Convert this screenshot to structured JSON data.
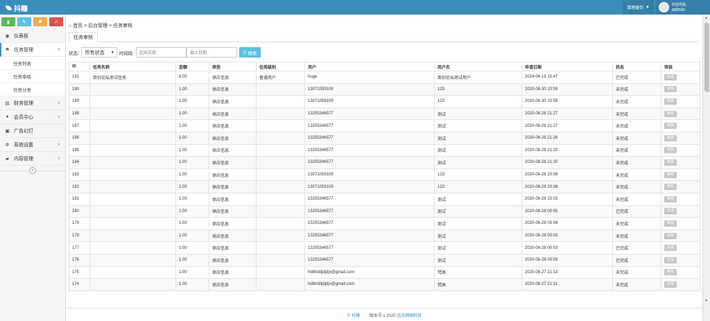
{
  "header": {
    "logo": "抖赚",
    "cache_label": "清理缓存",
    "user_greeting": "欢迎光临,",
    "user_name": "admin"
  },
  "sidebar": {
    "shortcut_colors": [
      "#5cb85c",
      "#5bc0de",
      "#f0ad4e",
      "#d9534f"
    ],
    "items": [
      {
        "label": "仪表板",
        "icon": "dashboard-icon"
      },
      {
        "label": "任务管理",
        "icon": "flag-icon"
      },
      {
        "label": "财务管理",
        "icon": "finance-icon"
      },
      {
        "label": "会员中心",
        "icon": "user-icon"
      },
      {
        "label": "广告幻灯",
        "icon": "picture-icon"
      },
      {
        "label": "系统设置",
        "icon": "gear-icon"
      },
      {
        "label": "内容管理",
        "icon": "book-icon"
      }
    ],
    "sub_items": [
      "任务列表",
      "任务审核",
      "任务分类"
    ]
  },
  "breadcrumb": {
    "home": "首页",
    "sep": ">",
    "level1": "后台管理",
    "level2": "任务审核"
  },
  "tab": {
    "label": "任务审核"
  },
  "filter": {
    "status_label": "状态:",
    "status_value": "所有状态",
    "time_label": "时间段:",
    "start_placeholder": "起始日期",
    "end_placeholder": "截止日期",
    "search_label": "搜索"
  },
  "table": {
    "columns": [
      "ID",
      "任务名称",
      "金额",
      "类型",
      "任务级别",
      "用户",
      "用户名",
      "申请日期",
      "状态",
      "审核"
    ],
    "rows": [
      [
        "191",
        "商创论坛测试任务",
        "8.00",
        "供应信息",
        "普通用户",
        "huge",
        "商创论坛测试用户",
        "2024-04-19 15:47",
        "已完成",
        "完成"
      ],
      [
        "190",
        "",
        "1.00",
        "供应信息",
        "",
        "13071059109",
        "123",
        "2020-08-30 10:59",
        "未完成",
        "审核"
      ],
      [
        "189",
        "",
        "1.00",
        "供应信息",
        "",
        "13071059109",
        "123",
        "2020-08-30 10:59",
        "未完成",
        "审核"
      ],
      [
        "188",
        "",
        "1.00",
        "供应信息",
        "",
        "13255346577",
        "测试",
        "2020-08-28 21:27",
        "未完成",
        "审核"
      ],
      [
        "187",
        "",
        "1.00",
        "供应信息",
        "",
        "13255346577",
        "测试",
        "2020-08-28 21:27",
        "未完成",
        "审核"
      ],
      [
        "186",
        "",
        "1.00",
        "供应信息",
        "",
        "13255346577",
        "测试",
        "2020-08-28 21:26",
        "未完成",
        "审核"
      ],
      [
        "185",
        "",
        "1.00",
        "供应信息",
        "",
        "13255346577",
        "测试",
        "2020-08-28 21:20",
        "未完成",
        "审核"
      ],
      [
        "184",
        "",
        "1.00",
        "供应信息",
        "",
        "13255346577",
        "测试",
        "2020-08-28 21:20",
        "未完成",
        "审核"
      ],
      [
        "183",
        "",
        "1.00",
        "供应信息",
        "",
        "13071059109",
        "123",
        "2020-08-28 20:08",
        "未完成",
        "审核"
      ],
      [
        "182",
        "",
        "1.00",
        "供应信息",
        "",
        "13071059109",
        "123",
        "2020-08-28 20:08",
        "未完成",
        "审核"
      ],
      [
        "181",
        "",
        "1.00",
        "供应信息",
        "",
        "13255346577",
        "测试",
        "2020-08-28 15:03",
        "未完成",
        "审核"
      ],
      [
        "180",
        "",
        "1.00",
        "供应信息",
        "",
        "13255346577",
        "测试",
        "2020-08-28 00:05",
        "已完成",
        "完成"
      ],
      [
        "179",
        "",
        "1.00",
        "供应信息",
        "",
        "13255346577",
        "测试",
        "2020-08-28 00:04",
        "未完成",
        "审核"
      ],
      [
        "178",
        "",
        "1.00",
        "供应信息",
        "",
        "13255346577",
        "测试",
        "2020-08-28 00:03",
        "未完成",
        "审核"
      ],
      [
        "177",
        "",
        "1.00",
        "供应信息",
        "",
        "13255346577",
        "测试",
        "2020-08-28 00:03",
        "已完成",
        "完成"
      ],
      [
        "176",
        "",
        "1.00",
        "供应信息",
        "",
        "13255346577",
        "测试",
        "2020-08-28 00:03",
        "已完成",
        "完成"
      ],
      [
        "175",
        "",
        "1.00",
        "供应信息",
        "",
        "hdbhddjdjdjx@gmail.com",
        "梵高",
        "2020-08-27 21:13",
        "未完成",
        "审核"
      ],
      [
        "174",
        "",
        "1.00",
        "供应信息",
        "",
        "hdbhddjdjdjx@gmail.com",
        "梵高",
        "2020-08-27 21:11",
        "未完成",
        "审核"
      ]
    ]
  },
  "footer": {
    "brand": "© 抖赚",
    "version": "版本号 v 2020",
    "company": "迅光网络科技"
  },
  "colors": {
    "topbar": "#3c8dbc",
    "accent": "#5bc0de"
  }
}
